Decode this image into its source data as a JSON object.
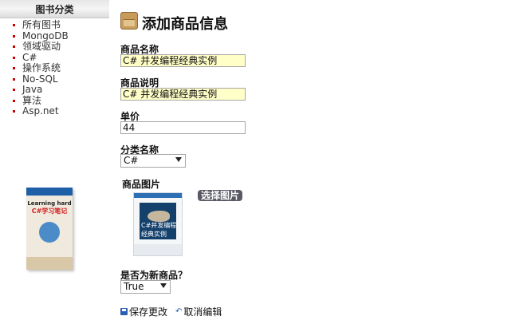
{
  "sidebar": {
    "header": "图书分类",
    "items": [
      "所有图书",
      "MongoDB",
      "领域驱动",
      "C#",
      "操作系统",
      "No-SQL",
      "Java",
      "算法",
      "Asp.net"
    ],
    "ad_book": {
      "title_en": "Learning hard",
      "title_cn": "C#学习笔记"
    }
  },
  "form": {
    "title": "添加商品信息",
    "name_label": "商品名称",
    "name_value": "C# 并发编程经典实例",
    "desc_label": "商品说明",
    "desc_value": "C# 并发编程经典实例",
    "price_label": "单价",
    "price_value": "44",
    "category_label": "分类名称",
    "category_value": "C#",
    "image_label": "商品图片",
    "pick_image_button": "选择图片",
    "book_cover_title": [
      "C#并发编程",
      "经典实例"
    ],
    "is_new_label": "是否为新商品？",
    "is_new_value": "True"
  },
  "actions": {
    "save": "保存更改",
    "cancel": "取消编辑"
  },
  "colors": {
    "highlight_field": "#ffffc8",
    "bullet": "#cc0000",
    "link_icon": "#2a62b4"
  }
}
